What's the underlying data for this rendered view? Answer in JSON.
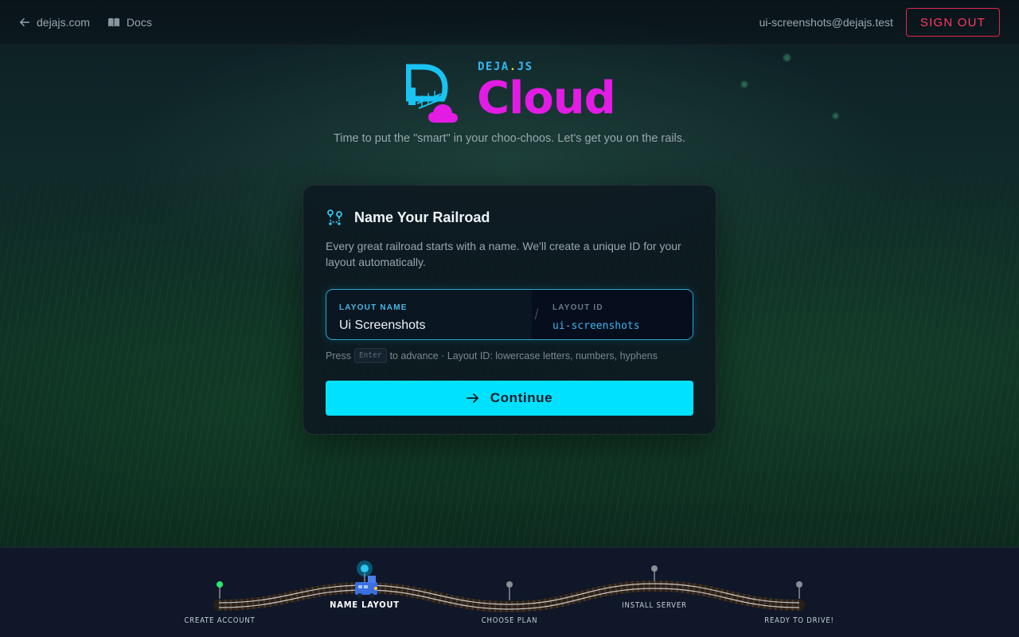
{
  "header": {
    "home_link": "dejajs.com",
    "docs_link": "Docs",
    "user_email": "ui-screenshots@dejajs.test",
    "signout_label": "SIGN OUT"
  },
  "brand": {
    "small_prefix": "DEJA",
    "small_dot": ".",
    "small_suffix": "JS",
    "name": "Cloud",
    "tagline": "Time to put the \"smart\" in your choo-choos. Let's get you on the rails."
  },
  "card": {
    "title": "Name Your Railroad",
    "description": "Every great railroad starts with a name. We'll create a unique ID for your layout automatically.",
    "name_field_label": "LAYOUT NAME",
    "name_field_value": "Ui Screenshots",
    "separator": "/",
    "id_field_label": "LAYOUT ID",
    "id_field_value": "ui-screenshots",
    "hint_prefix": "Press",
    "hint_key": "Enter",
    "hint_suffix": "to advance · Layout ID: lowercase letters, numbers, hyphens",
    "continue_label": "Continue"
  },
  "progress": {
    "steps": [
      {
        "label": "CREATE ACCOUNT",
        "status": "done"
      },
      {
        "label": "NAME LAYOUT",
        "status": "active"
      },
      {
        "label": "CHOOSE PLAN",
        "status": "pending"
      },
      {
        "label": "INSTALL SERVER",
        "status": "pending"
      },
      {
        "label": "READY TO DRIVE!",
        "status": "pending"
      }
    ]
  },
  "colors": {
    "accent": "#00e1ff",
    "brand_magenta": "#e21ce4",
    "signout_red": "#ff3b63",
    "done_green": "#2ee66b"
  }
}
